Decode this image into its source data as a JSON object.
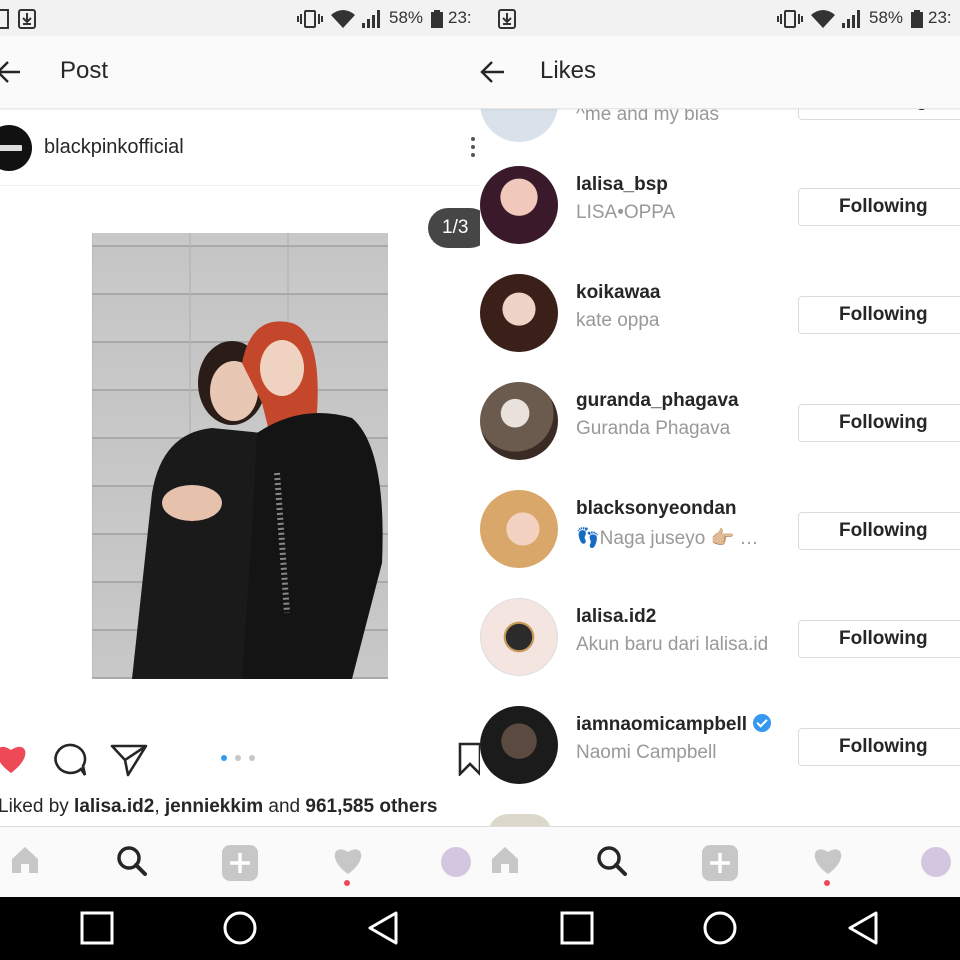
{
  "status": {
    "battery": "58%",
    "time": "23:",
    "time_right": "23:"
  },
  "post_screen": {
    "title": "Post",
    "username": "blackpinkofficial",
    "photo_counter": "1/3",
    "likes": {
      "prefix": "Liked by ",
      "user1": "lalisa.id2",
      "sep": ", ",
      "user2": "jenniekkim",
      "and": " and ",
      "others": "961,585 others"
    },
    "colors": {
      "heart": "#ed4956"
    }
  },
  "likes_screen": {
    "title": "Likes",
    "partial_row": {
      "fullname": "^me and my bias",
      "button": "Following"
    },
    "rows": [
      {
        "username": "lalisa_bsp",
        "fullname": "LISA•OPPA",
        "button": "Following",
        "verified": false
      },
      {
        "username": "koikawaa",
        "fullname": "kate oppa",
        "button": "Following",
        "verified": false
      },
      {
        "username": "guranda_phagava",
        "fullname": "Guranda Phagava",
        "button": "Following",
        "verified": false
      },
      {
        "username": "blacksonyeondan",
        "fullname": "👣Naga juseyo 👉🏼 …",
        "button": "Following",
        "verified": false
      },
      {
        "username": "lalisa.id2",
        "fullname": "Akun baru dari lalisa.id",
        "button": "Following",
        "verified": true
      },
      {
        "username": "iamnaomicampbell",
        "fullname": "Naomi Campbell",
        "button": "Following",
        "verified": true
      }
    ]
  },
  "nav": [
    "home-icon",
    "search-icon",
    "add-icon",
    "heart-icon",
    "profile-avatar"
  ],
  "system_nav": [
    "recents-square-icon",
    "home-circle-icon",
    "back-triangle-icon"
  ]
}
